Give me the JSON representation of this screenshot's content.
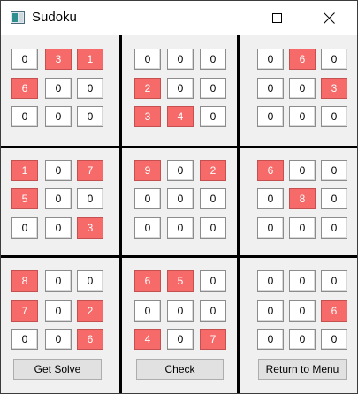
{
  "window": {
    "title": "Sudoku",
    "icon": "sudoku-app-icon"
  },
  "board": {
    "rows": [
      [
        "0",
        "3",
        "1",
        "0",
        "0",
        "0",
        "0",
        "6",
        "0"
      ],
      [
        "6",
        "0",
        "0",
        "2",
        "0",
        "0",
        "0",
        "0",
        "3"
      ],
      [
        "0",
        "0",
        "0",
        "3",
        "4",
        "0",
        "0",
        "0",
        "0"
      ],
      [
        "1",
        "0",
        "7",
        "9",
        "0",
        "2",
        "6",
        "0",
        "0"
      ],
      [
        "5",
        "0",
        "0",
        "0",
        "0",
        "0",
        "0",
        "8",
        "0"
      ],
      [
        "0",
        "0",
        "3",
        "0",
        "0",
        "0",
        "0",
        "0",
        "0"
      ],
      [
        "8",
        "0",
        "0",
        "6",
        "5",
        "0",
        "0",
        "0",
        "0"
      ],
      [
        "7",
        "0",
        "2",
        "0",
        "0",
        "0",
        "0",
        "0",
        "6"
      ],
      [
        "0",
        "0",
        "6",
        "4",
        "0",
        "7",
        "0",
        "0",
        "0"
      ]
    ],
    "given_color": "#f66a6a",
    "empty_color": "#ffffff"
  },
  "buttons": {
    "solve": "Get Solve",
    "check": "Check",
    "menu": "Return to Menu"
  }
}
